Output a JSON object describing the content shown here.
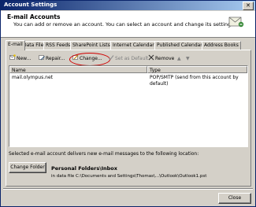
{
  "window": {
    "title": "Account Settings",
    "close_glyph": "✕"
  },
  "header": {
    "title": "E-mail Accounts",
    "subtitle": "You can add or remove an account. You can select an account and change its settings."
  },
  "tabs": [
    {
      "label": "E-mail",
      "active": true
    },
    {
      "label": "Data Files"
    },
    {
      "label": "RSS Feeds"
    },
    {
      "label": "SharePoint Lists"
    },
    {
      "label": "Internet Calendars"
    },
    {
      "label": "Published Calendars"
    },
    {
      "label": "Address Books"
    }
  ],
  "toolbar": {
    "new": "New...",
    "repair": "Repair...",
    "change": "Change...",
    "set_default": "Set as Default",
    "remove": "Remove",
    "up_glyph": "▲",
    "down_glyph": "▼"
  },
  "table": {
    "columns": [
      "Name",
      "Type"
    ],
    "rows": [
      {
        "name": "mail.olympus.net",
        "type": "POP/SMTP (send from this account by default)"
      }
    ]
  },
  "delivery": {
    "note": "Selected e-mail account delivers new e-mail messages to the following location:",
    "change_folder": "Change Folder",
    "folder": "Personal Folders\\Inbox",
    "path": "in data file C:\\Documents and Settings\\Thomas\\...\\Outlook\\Outlook1.pst"
  },
  "footer": {
    "close": "Close"
  },
  "colors": {
    "title_bar": "#0a246a",
    "face": "#d4d0c8",
    "highlight": "#d00000"
  }
}
